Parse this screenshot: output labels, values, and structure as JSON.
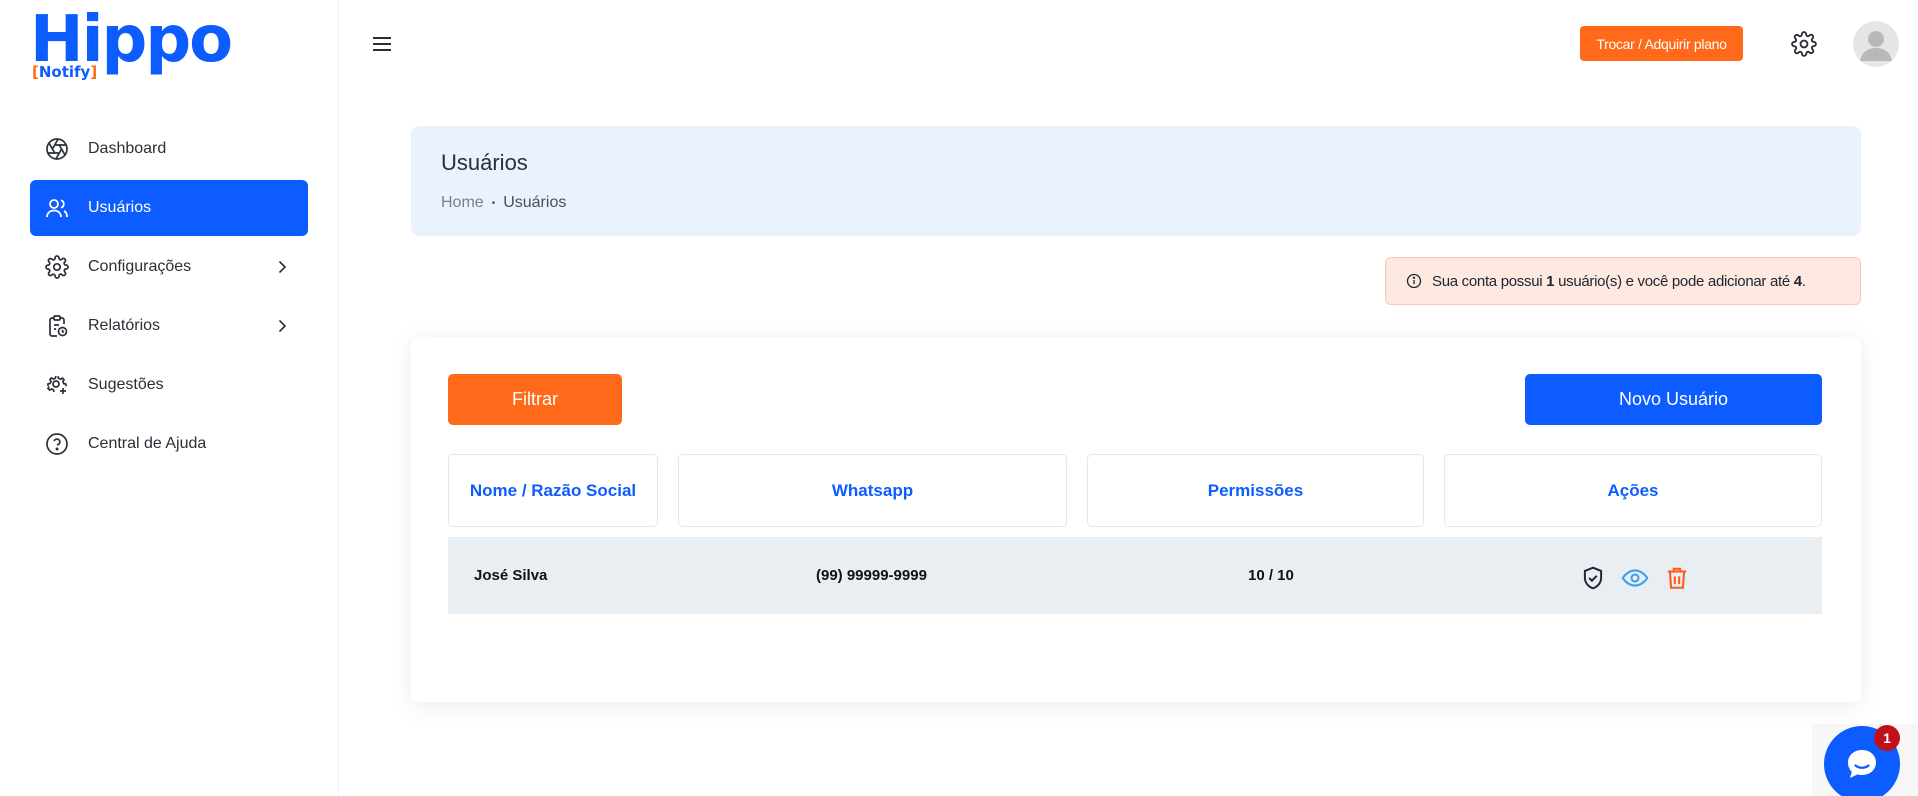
{
  "logo": {
    "main": "Hippo",
    "sub_open": "[",
    "sub_text": "Notify",
    "sub_close": "]"
  },
  "sidebar": {
    "items": [
      {
        "label": "Dashboard",
        "icon": "aperture-icon"
      },
      {
        "label": "Usuários",
        "icon": "users-icon",
        "active": true
      },
      {
        "label": "Configurações",
        "icon": "gear-icon",
        "has_submenu": true
      },
      {
        "label": "Relatórios",
        "icon": "clipboard-clock-icon",
        "has_submenu": true
      },
      {
        "label": "Sugestões",
        "icon": "gear-plus-icon"
      },
      {
        "label": "Central de Ajuda",
        "icon": "help-circle-icon"
      }
    ]
  },
  "topbar": {
    "plan_button": "Trocar / Adquirir plano"
  },
  "page": {
    "title": "Usuários",
    "breadcrumb": {
      "home": "Home",
      "separator": "•",
      "current": "Usuários"
    }
  },
  "alert": {
    "pre": "Sua conta possui ",
    "count": "1",
    "mid": " usuário(s) e você pode adicionar até ",
    "max": "4",
    "post": "."
  },
  "toolbar": {
    "filter_label": "Filtrar",
    "new_user_label": "Novo Usuário"
  },
  "table": {
    "headers": [
      "Nome / Razão Social",
      "Whatsapp",
      "Permissões",
      "Ações"
    ],
    "rows": [
      {
        "name": "José Silva",
        "whatsapp": "(99) 99999-9999",
        "permissions": "10 / 10"
      }
    ]
  },
  "chat": {
    "badge": "1"
  },
  "colors": {
    "primary": "#0d5cff",
    "accent": "#ff6a1a",
    "danger": "#c0111b"
  }
}
